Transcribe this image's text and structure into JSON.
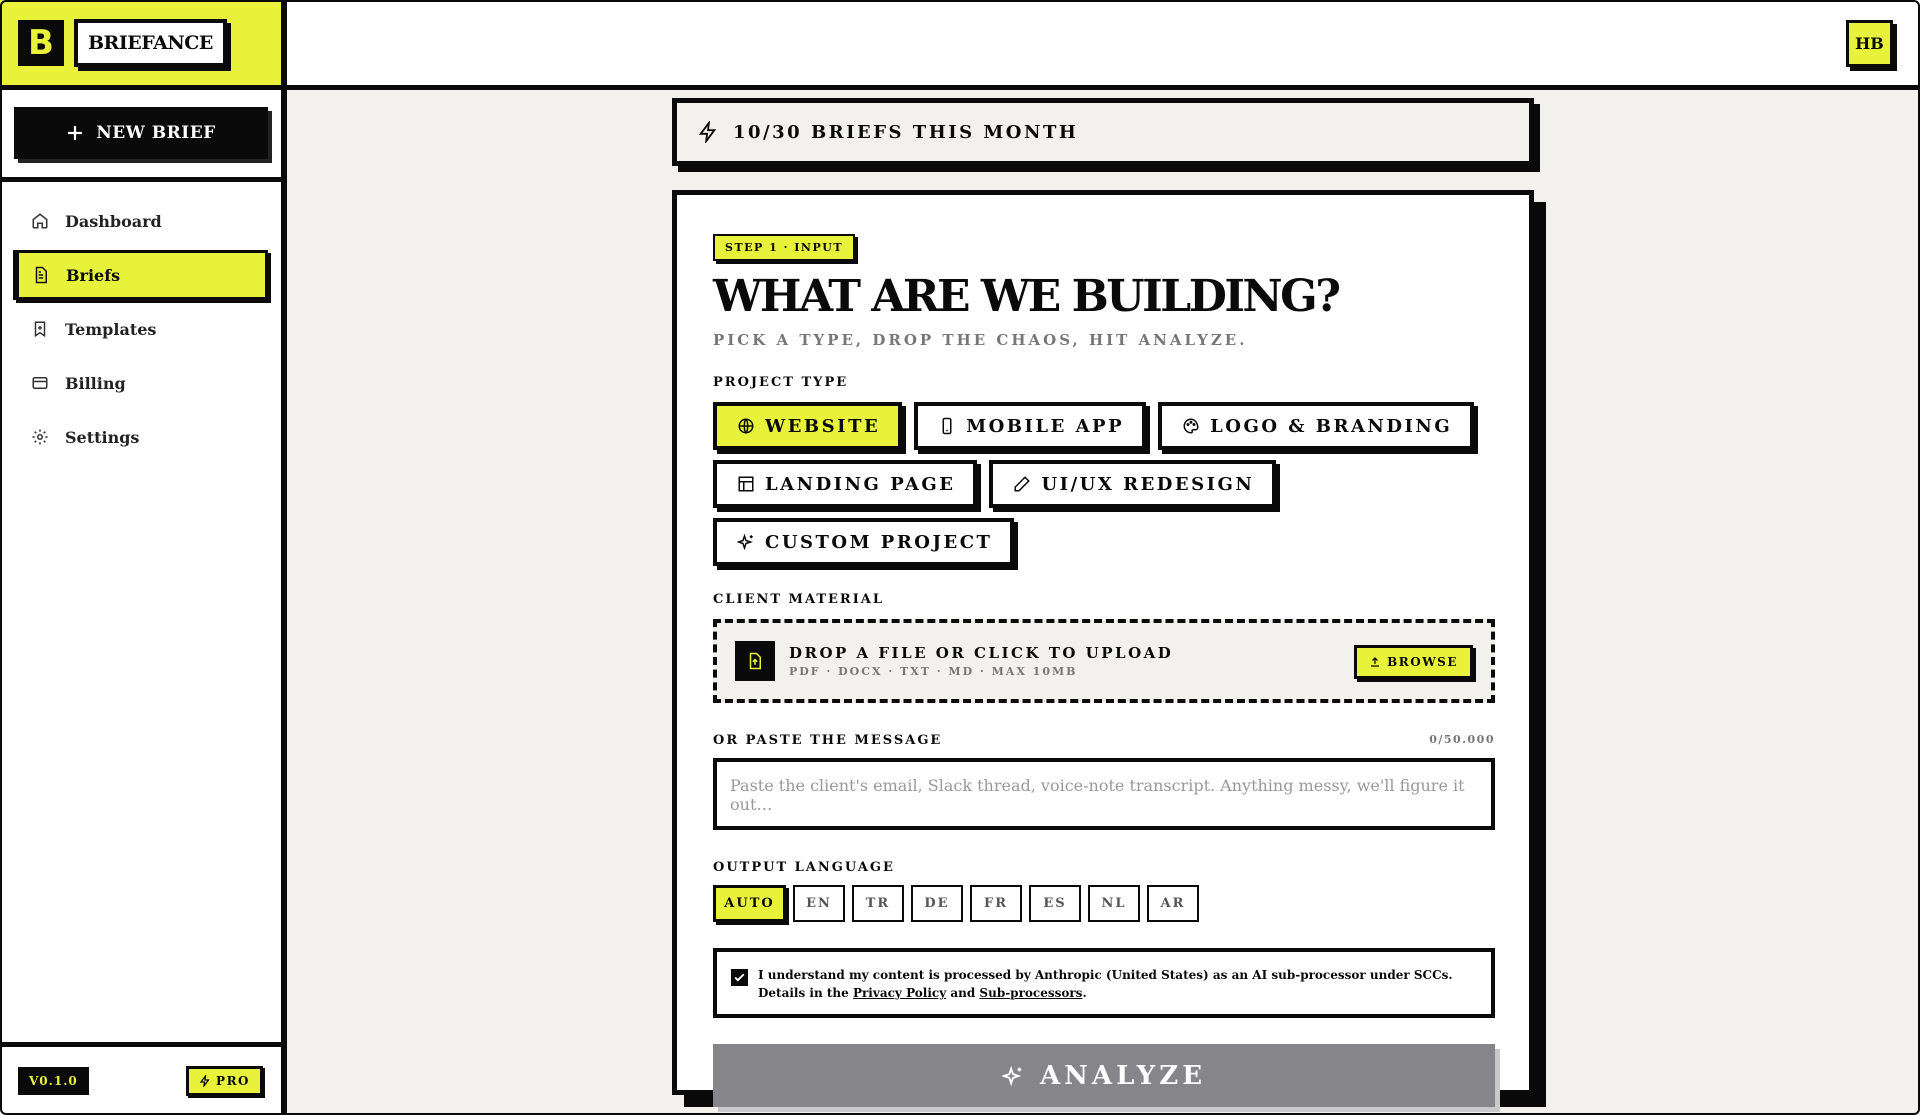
{
  "app": {
    "brand_letter": "B",
    "brand_name": "BRIEFANCE",
    "version": "V0.1.0",
    "plan": "PRO"
  },
  "colors": {
    "accent": "#e8f23a",
    "ink": "#0a0a0a",
    "background": "#f2f1ee",
    "disabled": "#85858a"
  },
  "sidebar": {
    "new_brief_label": "NEW BRIEF",
    "items": [
      {
        "label": "Dashboard",
        "icon": "home-icon"
      },
      {
        "label": "Briefs",
        "icon": "document-icon",
        "active": true
      },
      {
        "label": "Templates",
        "icon": "bookmark-icon"
      },
      {
        "label": "Billing",
        "icon": "card-icon"
      },
      {
        "label": "Settings",
        "icon": "gear-icon"
      }
    ]
  },
  "header": {
    "avatar_initials": "HB"
  },
  "quota": {
    "text": "10/30 BRIEFS THIS MONTH"
  },
  "form": {
    "step": "STEP 1 · INPUT",
    "title": "WHAT ARE WE BUILDING?",
    "subtitle": "PICK A TYPE, DROP THE CHAOS, HIT ANALYZE.",
    "project_type_label": "PROJECT TYPE",
    "project_types": [
      {
        "label": "WEBSITE",
        "icon": "globe-icon",
        "selected": true
      },
      {
        "label": "MOBILE APP",
        "icon": "phone-icon"
      },
      {
        "label": "LOGO & BRANDING",
        "icon": "palette-icon"
      },
      {
        "label": "LANDING PAGE",
        "icon": "layout-icon"
      },
      {
        "label": "UI/UX REDESIGN",
        "icon": "pencil-icon"
      },
      {
        "label": "CUSTOM PROJECT",
        "icon": "sparkles-icon"
      }
    ],
    "client_material_label": "CLIENT MATERIAL",
    "upload_title": "DROP A FILE OR CLICK TO UPLOAD",
    "upload_hint": "PDF · DOCX · TXT · MD · MAX 10MB",
    "browse_label": "BROWSE",
    "paste_label": "OR PASTE THE MESSAGE",
    "paste_counter": "0/50.000",
    "paste_placeholder": "Paste the client's email, Slack thread, voice-note transcript. Anything messy, we'll figure it out…",
    "output_language_label": "OUTPUT LANGUAGE",
    "languages": [
      "AUTO",
      "EN",
      "TR",
      "DE",
      "FR",
      "ES",
      "NL",
      "AR"
    ],
    "selected_language": "AUTO",
    "consent": {
      "checked": true,
      "text_before": "I understand my content is processed by Anthropic (United States) as an AI sub-processor under SCCs. Details in the ",
      "privacy_link": "Privacy Policy",
      "and": " and ",
      "subprocessors_link": "Sub-processors",
      "end": "."
    },
    "analyze_label": "ANALYZE"
  }
}
